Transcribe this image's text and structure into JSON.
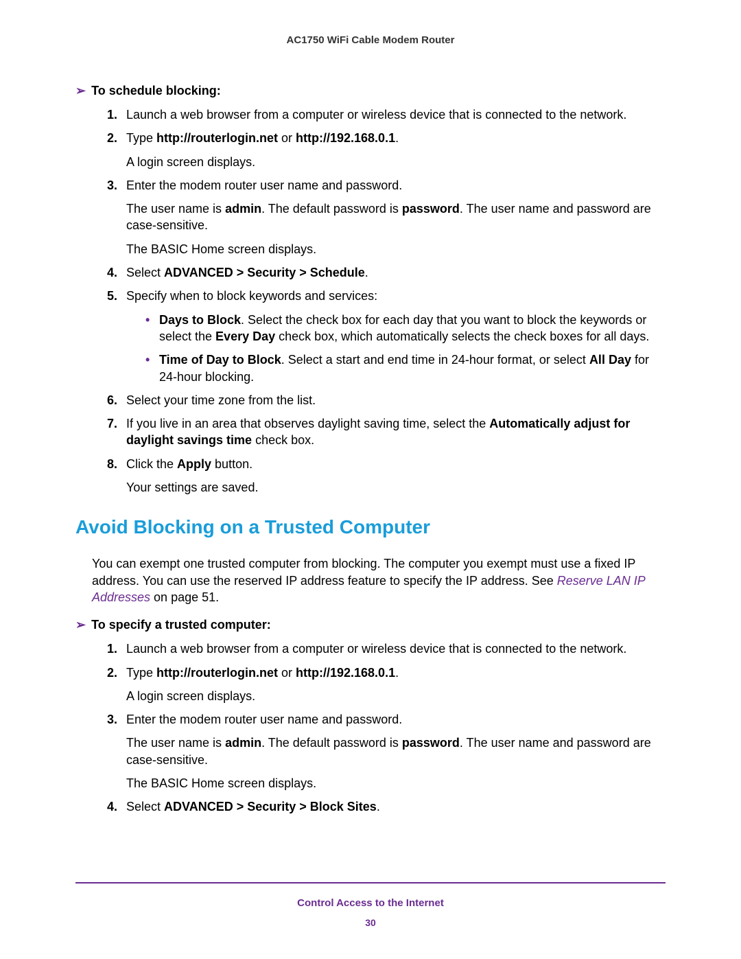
{
  "header": {
    "title": "AC1750 WiFi Cable Modem Router"
  },
  "section1": {
    "procHeading": "To schedule blocking:",
    "steps": [
      {
        "num": "1.",
        "main": "Launch a web browser from a computer or wireless device that is connected to the network."
      },
      {
        "num": "2.",
        "prefix": "Type ",
        "bold1": "http://routerlogin.net",
        "mid": " or ",
        "bold2": "http://192.168.0.1",
        "suffix": ".",
        "after": "A login screen displays."
      },
      {
        "num": "3.",
        "main": "Enter the modem router user name and password.",
        "para1_pre": "The user name is ",
        "para1_b1": "admin",
        "para1_mid": ". The default password is ",
        "para1_b2": "password",
        "para1_suf": ". The user name and password are case-sensitive.",
        "para2": "The BASIC Home screen displays."
      },
      {
        "num": "4.",
        "prefix": "Select ",
        "bold1": "ADVANCED > Security > Schedule",
        "suffix": "."
      },
      {
        "num": "5.",
        "main": "Specify when to block keywords and services:",
        "bullets": [
          {
            "b1": "Days to Block",
            "t1": ". Select the check box for each day that you want to block the keywords or select the ",
            "b2": "Every Day",
            "t2": " check box, which automatically selects the check boxes for all days."
          },
          {
            "b1": "Time of Day to Block",
            "t1": ". Select a start and end time in 24-hour format, or select ",
            "b2": "All Day",
            "t2": " for 24-hour blocking."
          }
        ]
      },
      {
        "num": "6.",
        "main": "Select your time zone from the list."
      },
      {
        "num": "7.",
        "prefix": "If you live in an area that observes daylight saving time, select the ",
        "bold1": "Automatically adjust for daylight savings time",
        "suffix": " check box."
      },
      {
        "num": "8.",
        "prefix": "Click the ",
        "bold1": "Apply",
        "suffix": " button.",
        "after": "Your settings are saved."
      }
    ]
  },
  "section2": {
    "heading": "Avoid Blocking on a Trusted Computer",
    "intro_pre": "You can exempt one trusted computer from blocking. The computer you exempt must use a fixed IP address. You can use the reserved IP address feature to specify the IP address. See ",
    "intro_link": "Reserve LAN IP Addresses",
    "intro_suf": " on page 51.",
    "procHeading": "To specify a trusted computer:",
    "steps": [
      {
        "num": "1.",
        "main": "Launch a web browser from a computer or wireless device that is connected to the network."
      },
      {
        "num": "2.",
        "prefix": "Type ",
        "bold1": "http://routerlogin.net",
        "mid": " or ",
        "bold2": "http://192.168.0.1",
        "suffix": ".",
        "after": "A login screen displays."
      },
      {
        "num": "3.",
        "main": "Enter the modem router user name and password.",
        "para1_pre": "The user name is ",
        "para1_b1": "admin",
        "para1_mid": ". The default password is ",
        "para1_b2": "password",
        "para1_suf": ". The user name and password are case-sensitive.",
        "para2": "The BASIC Home screen displays."
      },
      {
        "num": "4.",
        "prefix": "Select ",
        "bold1": "ADVANCED > Security > Block Sites",
        "suffix": "."
      }
    ]
  },
  "footer": {
    "title": "Control Access to the Internet",
    "page": "30"
  }
}
